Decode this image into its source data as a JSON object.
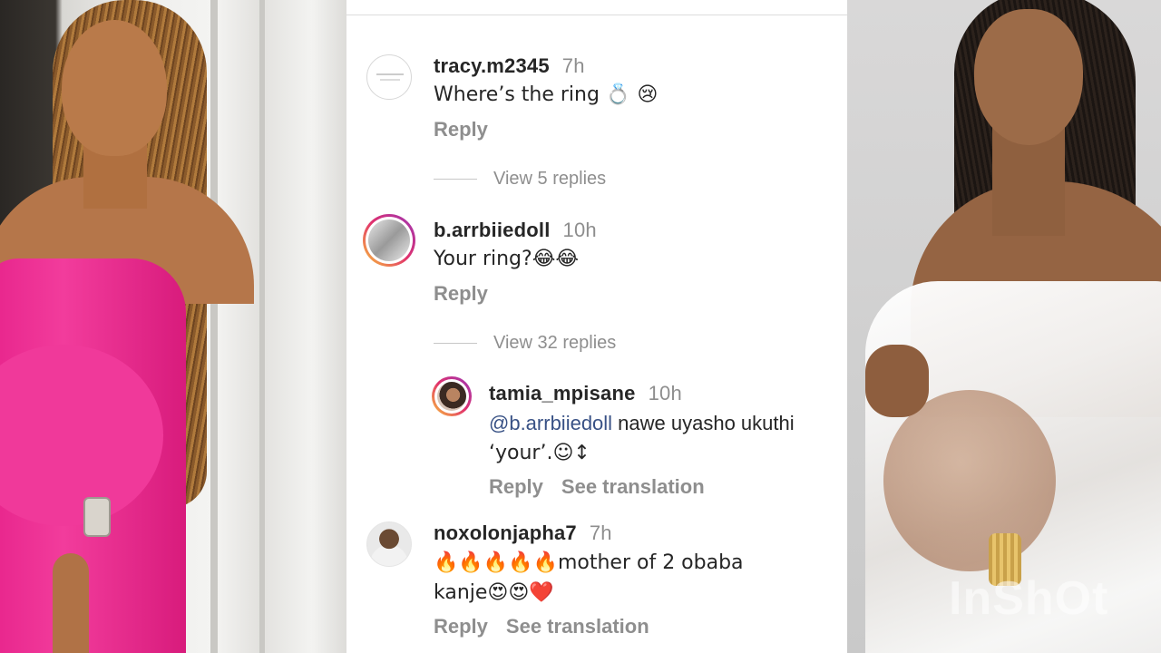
{
  "comments": [
    {
      "username": "tracy.m2345",
      "time": "7h",
      "text": "Where’s the ring 💍 😢",
      "reply_label": "Reply",
      "view_replies": "View 5 replies"
    },
    {
      "username": "b.arrbiiedoll",
      "time": "10h",
      "text": "Your ring?😂😂",
      "reply_label": "Reply",
      "view_replies": "View 32 replies"
    },
    {
      "username": "tamia_mpisane",
      "time": "10h",
      "mention": "@b.arrbiiedoll",
      "text_line1": " nawe uyasho ukuthi",
      "text_line2": "‘your’.☺↕",
      "reply_label": "Reply",
      "translate_label": "See translation"
    },
    {
      "username": "noxolonjapha7",
      "time": "7h",
      "text_line1": "🔥🔥🔥🔥🔥mother of 2 obaba",
      "text_line2": "kanje😍😍❤️",
      "reply_label": "Reply",
      "translate_label": "See translation"
    }
  ],
  "watermark": "InShOt"
}
